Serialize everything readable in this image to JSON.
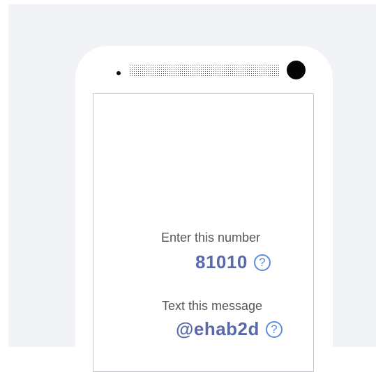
{
  "instructions": {
    "number_label": "Enter this number",
    "number_value": "81010",
    "message_label": "Text this message",
    "message_value": "@ehab2d",
    "help_glyph": "?"
  },
  "icons": {
    "help": "question-circle-icon"
  },
  "colors": {
    "value_text": "#5a6aa8",
    "help_icon": "#5a8fe0",
    "label_text": "#55565a",
    "background": "#f2f3f6"
  }
}
